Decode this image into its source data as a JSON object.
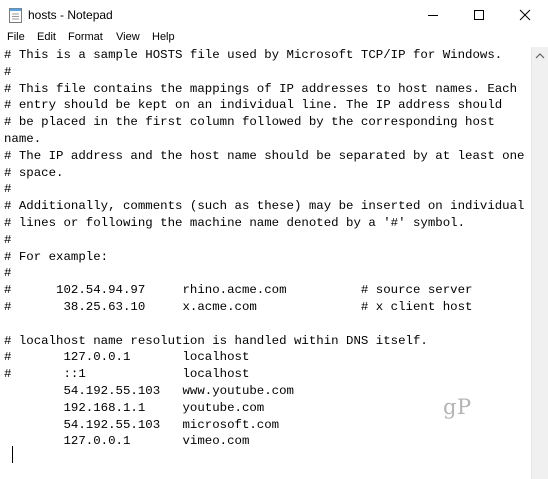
{
  "window": {
    "title": "hosts - Notepad"
  },
  "menu": {
    "items": [
      "File",
      "Edit",
      "Format",
      "View",
      "Help"
    ]
  },
  "editor": {
    "lines": [
      "# This is a sample HOSTS file used by Microsoft TCP/IP for Windows.",
      "#",
      "# This file contains the mappings of IP addresses to host names. Each",
      "# entry should be kept on an individual line. The IP address should",
      "# be placed in the first column followed by the corresponding host",
      "name.",
      "# The IP address and the host name should be separated by at least one",
      "# space.",
      "#",
      "# Additionally, comments (such as these) may be inserted on individual",
      "# lines or following the machine name denoted by a '#' symbol.",
      "#",
      "# For example:",
      "#",
      "#      102.54.94.97     rhino.acme.com          # source server",
      "#       38.25.63.10     x.acme.com              # x client host",
      "",
      "# localhost name resolution is handled within DNS itself.",
      "#       127.0.0.1       localhost",
      "#       ::1             localhost",
      "        54.192.55.103   www.youtube.com",
      "        192.168.1.1     youtube.com",
      "        54.192.55.103   microsoft.com",
      "        127.0.0.1       vimeo.com"
    ]
  },
  "watermark": "gP",
  "icons": {
    "app": "notepad-icon",
    "minimize": "minimize-icon",
    "maximize": "maximize-icon",
    "close": "close-icon",
    "scroll_up": "scroll-up-arrow-icon"
  }
}
